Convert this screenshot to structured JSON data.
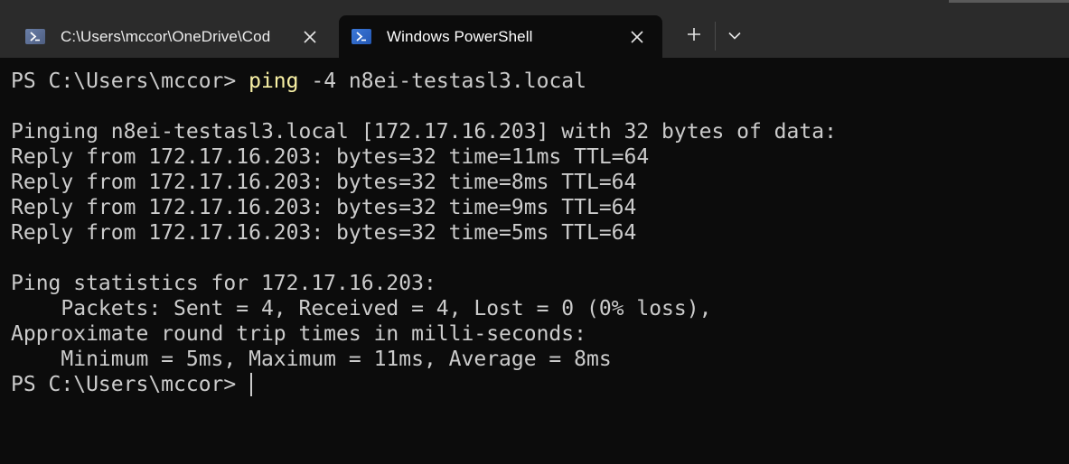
{
  "tabs": [
    {
      "title": "C:\\Users\\mccor\\OneDrive\\Cod",
      "icon": "powershell-icon",
      "active": false
    },
    {
      "title": "Windows PowerShell",
      "icon": "powershell-icon",
      "active": true
    }
  ],
  "icons": {
    "close": "close-icon",
    "new_tab": "plus-icon",
    "dropdown": "chevron-down-icon"
  },
  "terminal": {
    "prompt": "PS C:\\Users\\mccor> ",
    "command_name": "ping",
    "command_args": " -4 n8ei-testasl3.local",
    "output": [
      "",
      "Pinging n8ei-testasl3.local [172.17.16.203] with 32 bytes of data:",
      "Reply from 172.17.16.203: bytes=32 time=11ms TTL=64",
      "Reply from 172.17.16.203: bytes=32 time=8ms TTL=64",
      "Reply from 172.17.16.203: bytes=32 time=9ms TTL=64",
      "Reply from 172.17.16.203: bytes=32 time=5ms TTL=64",
      "",
      "Ping statistics for 172.17.16.203:",
      "    Packets: Sent = 4, Received = 4, Lost = 0 (0% loss),",
      "Approximate round trip times in milli-seconds:",
      "    Minimum = 5ms, Maximum = 11ms, Average = 8ms"
    ],
    "final_prompt": "PS C:\\Users\\mccor> "
  },
  "colors": {
    "background": "#0c0c0c",
    "text": "#cccccc",
    "command_highlight": "#f9f1a5",
    "tabbar": "#2b2b2b"
  }
}
